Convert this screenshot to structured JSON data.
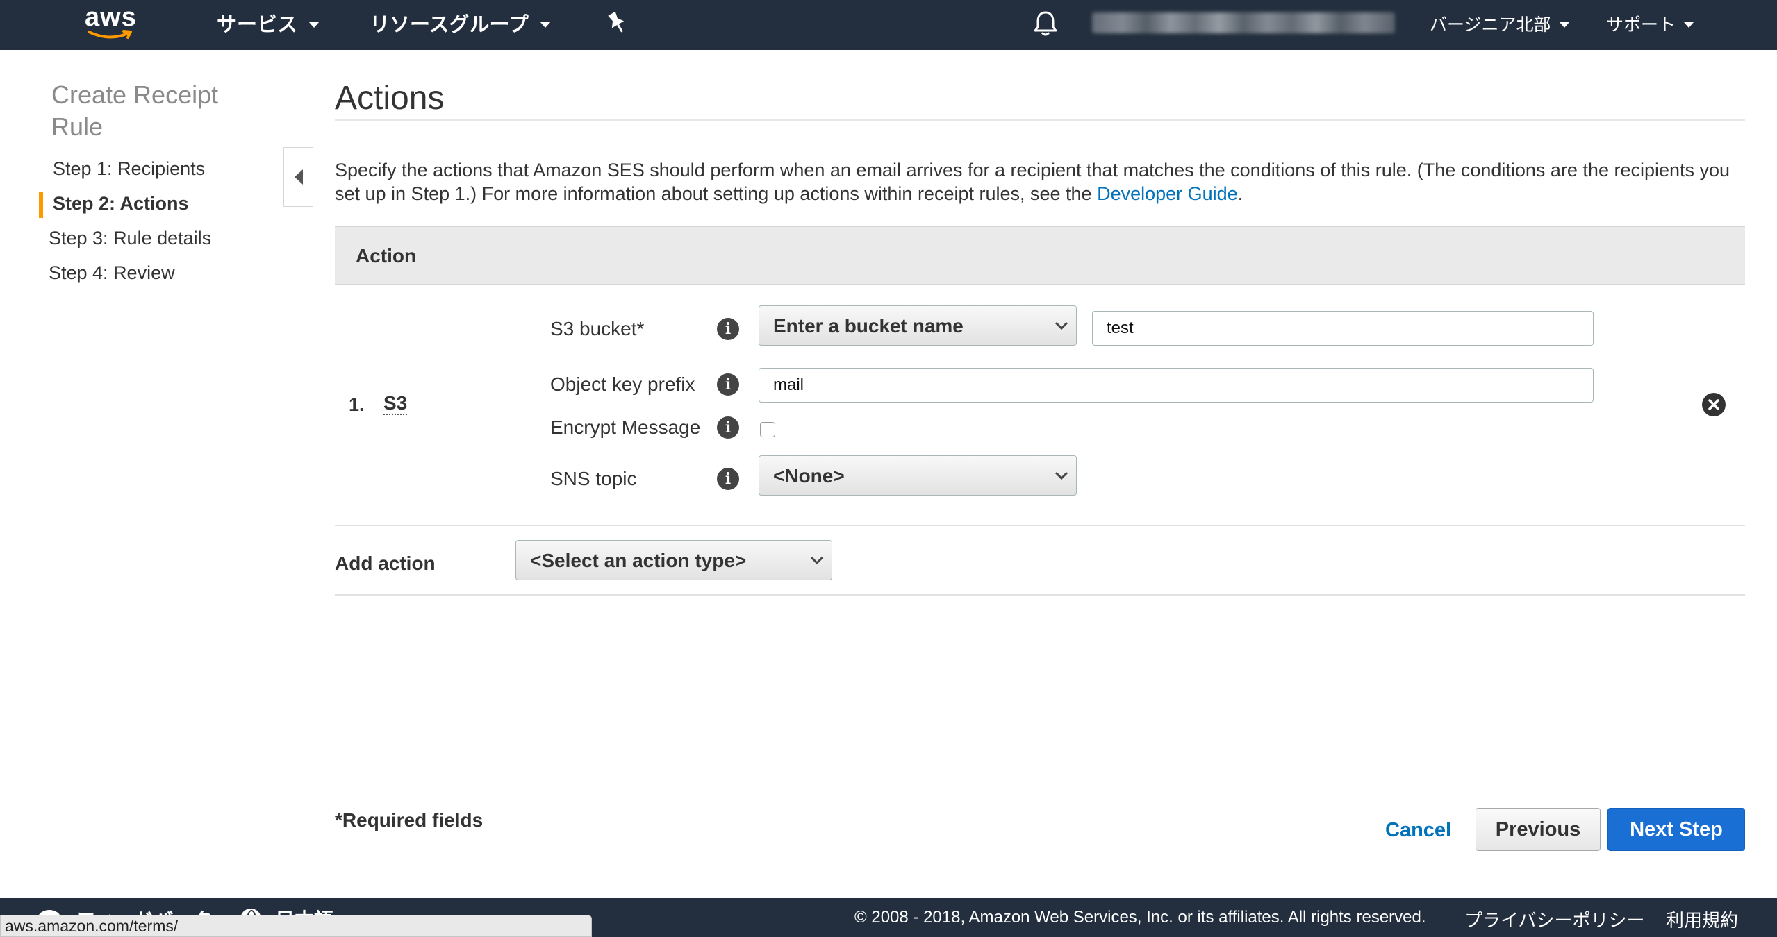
{
  "topbar": {
    "logo": "aws",
    "services_label": "サービス",
    "resource_groups_label": "リソースグループ",
    "region_label": "バージニア北部",
    "support_label": "サポート",
    "icons": {
      "pin": "pin-icon",
      "bell": "bell-icon"
    }
  },
  "sidebar": {
    "title": "Create Receipt Rule",
    "steps": [
      {
        "label": "Step 1: Recipients",
        "active": false
      },
      {
        "label": "Step 2: Actions",
        "active": true
      },
      {
        "label": "Step 3: Rule details",
        "active": false
      },
      {
        "label": "Step 4: Review",
        "active": false
      }
    ],
    "accent_color": "#ff9900"
  },
  "main": {
    "title": "Actions",
    "description_text": "Specify the actions that Amazon SES should perform when an email arrives for a recipient that matches the conditions of this rule. (The conditions are the recipients you set up in Step 1.) For more information about setting up actions within receipt rules, see the ",
    "description_link": "Developer Guide",
    "description_end": ".",
    "table_header": "Action",
    "action": {
      "number": "1.",
      "type": "S3",
      "fields": {
        "bucket_label": "S3 bucket*",
        "bucket_select": "Enter a bucket name",
        "bucket_value": "test",
        "prefix_label": "Object key prefix",
        "prefix_value": "mail",
        "encrypt_label": "Encrypt Message",
        "encrypt_checked": false,
        "sns_label": "SNS topic",
        "sns_select": "<None>"
      }
    },
    "add_action_label": "Add action",
    "add_action_select": "<Select an action type>",
    "required_note": "*Required fields",
    "cancel_label": "Cancel",
    "previous_label": "Previous",
    "next_label": "Next Step",
    "primary_color": "#1a6fd4",
    "link_color": "#0073bb"
  },
  "footer": {
    "feedback_label": "フィードバック",
    "language_label": "日本語",
    "copyright": "© 2008 - 2018, Amazon Web Services, Inc. or its affiliates. All rights reserved.",
    "privacy_label": "プライバシーポリシー",
    "terms_label": "利用規約"
  },
  "status_bar": {
    "url": "aws.amazon.com/terms/"
  }
}
